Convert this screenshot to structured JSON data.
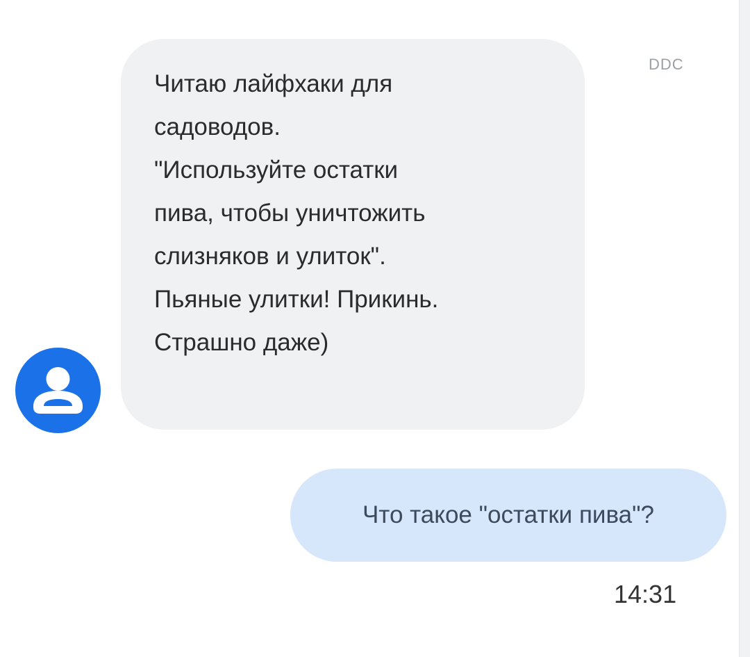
{
  "incoming": {
    "lines": [
      "Читаю лайфхаки для",
      "садоводов.",
      "\"Используйте остатки",
      "пива, чтобы уничтожить",
      "слизняков и улиток\".",
      "Пьяные улитки! Прикинь.",
      "Страшно даже)"
    ]
  },
  "sender_tag": "DDC",
  "outgoing": {
    "text": "Что такое \"остатки пива\"?"
  },
  "timestamp": "14:31",
  "colors": {
    "avatar": "#1b72e8",
    "incoming_bubble": "#f0f1f3",
    "outgoing_bubble": "#d6e6fb"
  },
  "icons": {
    "avatar": "user-profile-icon"
  }
}
